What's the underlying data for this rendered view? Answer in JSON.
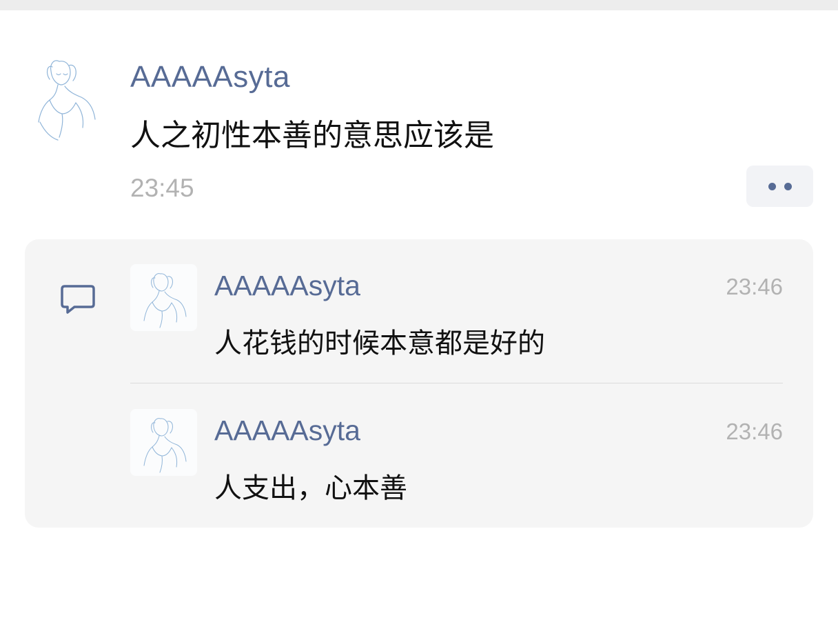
{
  "post": {
    "author": "AAAAAsyta",
    "text": "人之初性本善的意思应该是",
    "time": "23:45",
    "avatar_icon": "sketch-portrait-avatar",
    "more_icon": "more-dots-icon"
  },
  "comments": [
    {
      "author": "AAAAAsyta",
      "time": "23:46",
      "text": "人花钱的时候本意都是好的"
    },
    {
      "author": "AAAAAsyta",
      "time": "23:46",
      "text": "人支出，心本善"
    }
  ],
  "colors": {
    "name": "#576b95",
    "text": "#111111",
    "time": "#b2b2b2",
    "panel": "#f5f5f5"
  }
}
